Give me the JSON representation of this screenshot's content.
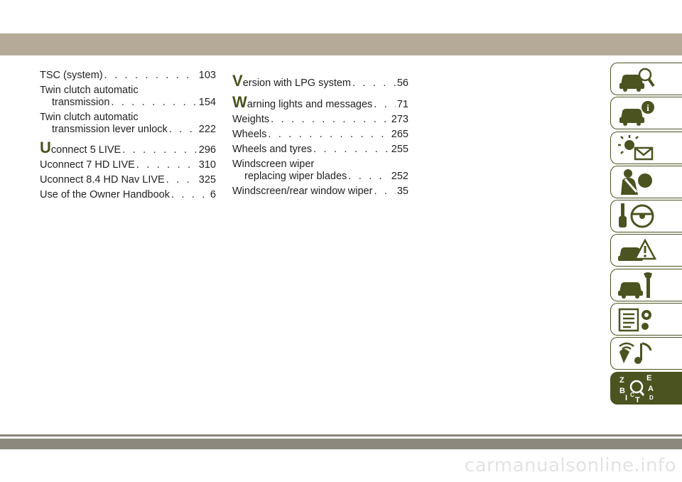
{
  "colors": {
    "accent": "#4b5320",
    "header_bar": "#b5aa97",
    "footer_bar": "#8d887e"
  },
  "left_column": [
    {
      "text": "TSC (system)",
      "page": "103"
    },
    {
      "line1": "Twin clutch automatic",
      "text": "transmission",
      "page": "154"
    },
    {
      "line1": "Twin clutch automatic",
      "text": "transmission lever unlock",
      "page": "222"
    },
    {
      "letter": "U",
      "text": "connect 5 LIVE",
      "page": "296"
    },
    {
      "text": "Uconnect 7 HD LIVE",
      "page": "310"
    },
    {
      "text": "Uconnect 8.4 HD Nav LIVE",
      "page": "325"
    },
    {
      "text": "Use of the Owner Handbook",
      "page": "6"
    }
  ],
  "mid_column": [
    {
      "letter": "V",
      "text": "ersion with LPG system",
      "page": "56"
    },
    {
      "letter": "W",
      "text": "arning lights and messages",
      "page": "71"
    },
    {
      "text": "Weights",
      "page": "273"
    },
    {
      "text": "Wheels",
      "page": "265"
    },
    {
      "text": "Wheels and tyres",
      "page": "255"
    },
    {
      "line1": "Windscreen wiper",
      "text": "replacing wiper blades",
      "page": "252"
    },
    {
      "text": "Windscreen/rear window wiper",
      "page": "35"
    }
  ],
  "tabs": [
    "car-search-icon",
    "car-info-icon",
    "warning-light-message-icon",
    "airbag-seatbelt-icon",
    "key-steering-icon",
    "car-crash-warning-icon",
    "car-wrench-icon",
    "specs-gear-icon",
    "multimedia-icon",
    "index-az-icon"
  ],
  "index_tab_letters": [
    "Z",
    "E",
    "B",
    "A",
    "I",
    "C",
    "D",
    "T"
  ],
  "dots": ". . . . . . . . . . . . . . . . . . . . . . . . . . . . . . . . . .",
  "watermark": "carmanualsonline.info"
}
